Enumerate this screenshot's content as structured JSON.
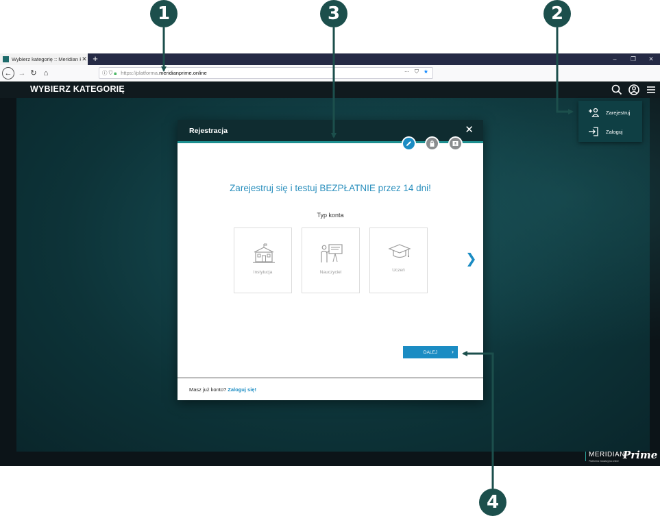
{
  "callouts": [
    "1",
    "2",
    "3",
    "4"
  ],
  "browser": {
    "tab_title": "Wybierz kategorię :: Meridian P",
    "tab_close": "✕",
    "new_tab": "+",
    "window_controls": [
      "–",
      "❐",
      "✕"
    ],
    "url_protocol": "https://platforma.",
    "url_host": "meridianprime.online",
    "url_right_icons": [
      "···",
      "⛉",
      "★"
    ],
    "star_color": "#0a84ff"
  },
  "page": {
    "title": "WYBIERZ KATEGORIĘ",
    "header_icons": [
      "search-icon",
      "user-icon",
      "menu-icon"
    ],
    "brand_main": "MERIDIAN",
    "brand_script": "Prime",
    "brand_sub": "Platforma edukacyjna online"
  },
  "dropdown": {
    "items": [
      {
        "label": "Zarejestruj",
        "icon": "add-user-icon"
      },
      {
        "label": "Zaloguj",
        "icon": "login-icon"
      }
    ]
  },
  "modal": {
    "title": "Rejestracja",
    "close": "✕",
    "steps": [
      {
        "icon": "pencil-icon",
        "active": true
      },
      {
        "icon": "lock-icon",
        "active": false
      },
      {
        "icon": "id-card-icon",
        "active": false
      }
    ],
    "headline": "Zarejestruj się i testuj BEZPŁATNIE przez 14 dni!",
    "account_type_label": "Typ konta",
    "cards": [
      {
        "label": "Instytucja",
        "icon": "school-icon"
      },
      {
        "label": "Nauczyciel",
        "icon": "teacher-icon"
      },
      {
        "label": "Uczeń",
        "icon": "graduation-cap-icon"
      }
    ],
    "next_arrow": "❯",
    "next_button": "DALEJ",
    "next_chevron": "›",
    "footer_text": "Masz już konto?",
    "footer_link": "Zaloguj się!",
    "accent_color": "#1b8cc3"
  }
}
